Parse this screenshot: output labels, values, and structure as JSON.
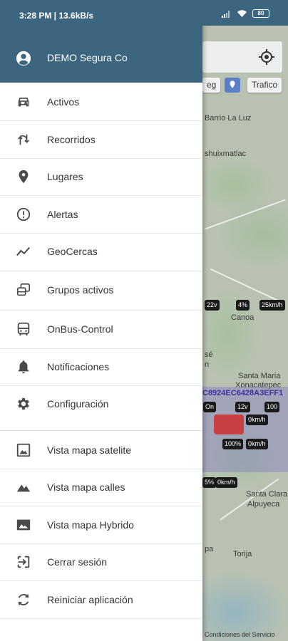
{
  "status_bar": {
    "time": "3:28 PM | 13.6kB/s",
    "battery": "80"
  },
  "drawer": {
    "account_name": "DEMO Segura Co",
    "menu_group_1": [
      {
        "label": "Activos",
        "icon": "car-icon"
      },
      {
        "label": "Recorridos",
        "icon": "route-icon"
      },
      {
        "label": "Lugares",
        "icon": "place-icon"
      },
      {
        "label": "Alertas",
        "icon": "alert-icon"
      },
      {
        "label": "GeoCercas",
        "icon": "timeline-icon"
      },
      {
        "label": "Grupos activos",
        "icon": "vehicle-group-icon"
      },
      {
        "label": "OnBus-Control",
        "icon": "bus-icon"
      },
      {
        "label": "Notificaciones",
        "icon": "bell-icon"
      },
      {
        "label": "Configuración",
        "icon": "gear-icon"
      }
    ],
    "menu_group_2": [
      {
        "label": "Vista mapa satelite",
        "icon": "image-icon"
      },
      {
        "label": "Vista mapa calles",
        "icon": "terrain-icon"
      },
      {
        "label": "Vista mapa Hybrido",
        "icon": "photo-icon"
      },
      {
        "label": "Cerrar sesión",
        "icon": "logout-icon"
      },
      {
        "label": "Reiniciar aplicación",
        "icon": "restart-icon"
      }
    ]
  },
  "map": {
    "chip_left": "eg",
    "chip_traffic": "Trafico",
    "labels": [
      "Barrio La Luz",
      "shuixmatlac",
      "Canoa",
      "sé",
      "n",
      "Santa Maria",
      "Xonacatepec",
      "Santa Clara",
      "Alpuyeca",
      "pa",
      "Torija"
    ],
    "vehicle_id": "C8924EC6428A3EFF1",
    "badges_row1": [
      "22v",
      "4%",
      "25km/h"
    ],
    "badges_row2": [
      "On",
      "12v",
      "100"
    ],
    "badges_row3": [
      "0km/h",
      "100%",
      "0km/h",
      "5%",
      "0km/h"
    ],
    "footer": "Condiciones del Servicio"
  },
  "colors": {
    "header": "#3c6580",
    "drawer_bg": "#ffffff",
    "icon": "#4a4a4a"
  }
}
